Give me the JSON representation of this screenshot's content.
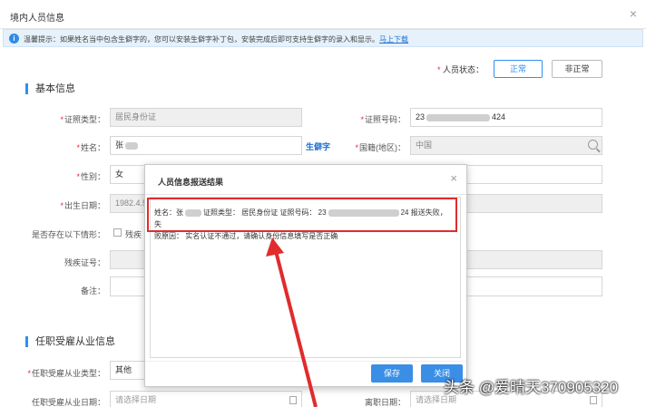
{
  "window": {
    "title": "境内人员信息",
    "close_label": "×"
  },
  "notice": {
    "text": "温馨提示：如果姓名当中包含生僻字的，您可以安装生僻字补丁包，安装完成后即可支持生僻字的录入和显示。",
    "link": "马上下载",
    "icon": "info-icon"
  },
  "status": {
    "label": "人员状态：",
    "options": [
      "正常",
      "非正常"
    ],
    "selected": "正常"
  },
  "basic": {
    "section_title": "基本信息",
    "id_type_label": "证照类型：",
    "id_type_value": "居民身份证",
    "id_number_label": "证照号码：",
    "id_number_prefix": "23",
    "id_number_suffix": "424",
    "name_label": "姓名：",
    "name_value": "张",
    "rare_char_link": "生僻字",
    "nationality_label": "国籍(地区)：",
    "nationality_value": "中国",
    "gender_label": "性别：",
    "gender_value": "女",
    "birth_label": "出生日期：",
    "birth_value": "1982.4.5",
    "situation_label": "是否存在以下情形：",
    "situation_option": "残疾",
    "disability_label": "残疾证号：",
    "remark_label": "备注："
  },
  "employment": {
    "section_title": "任职受雇从业信息",
    "type_label": "任职受雇从业类型：",
    "type_value": "其他",
    "date_label": "任职受雇从业日期：",
    "date_placeholder": "请选择日期",
    "leave_label": "离职日期：",
    "leave_placeholder": "请选择日期"
  },
  "dialog": {
    "title": "人员信息报送结果",
    "close_label": "×",
    "message_line1_a": "姓名：张",
    "message_line1_b": "证照类型：  居民身份证  证照号码：  23",
    "message_line1_c": "24 报送失败，失",
    "message_line2": "败原因：  实名认证不通过，请确认身份信息填写是否正确",
    "save_button": "保存",
    "close_button": "关闭"
  },
  "watermark": "头条 @爱晴天370905320",
  "colors": {
    "accent": "#2e8ff0",
    "highlight": "#e02c2c",
    "arrow": "#e02c2c"
  }
}
